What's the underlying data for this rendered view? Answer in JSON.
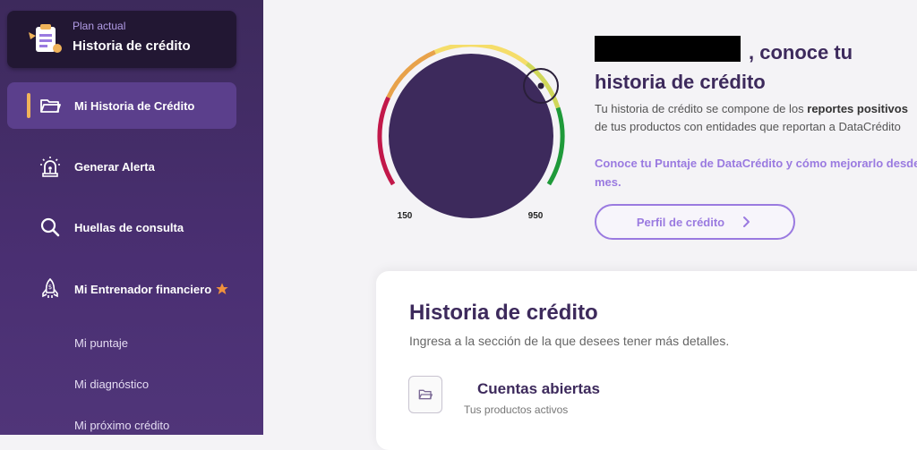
{
  "sidebar": {
    "plan": {
      "small": "Plan actual",
      "title": "Historia de crédito"
    },
    "items": [
      {
        "label": "Mi Historia de Crédito",
        "icon": "folder-icon",
        "active": true
      },
      {
        "label": "Generar Alerta",
        "icon": "alarm-light-icon",
        "active": false
      },
      {
        "label": "Huellas de consulta",
        "icon": "search-icon",
        "active": false
      },
      {
        "label": "Mi Entrenador financiero",
        "icon": "rocket-icon",
        "active": false,
        "badge": "star-icon"
      }
    ],
    "sub_items": [
      "Mi puntaje",
      "Mi diagnóstico",
      "Mi próximo crédito"
    ]
  },
  "gauge": {
    "min_label": "150",
    "max_label": "950"
  },
  "header": {
    "title_line1": ", conoce tu",
    "title_line2": "historia de crédito",
    "para_prefix": "Tu historia de crédito se compone de los ",
    "para_bold": "reportes positivos",
    "para_line2": "de tus productos con entidades que reportan a DataCrédito",
    "link_line1": "Conoce tu Puntaje de DataCrédito y cómo mejorarlo desde",
    "link_line2": "mes.",
    "profile_button": "Perfil de crédito"
  },
  "card": {
    "title": "Historia de crédito",
    "subtitle": "Ingresa a la sección de la que desees tener más detalles.",
    "account": {
      "title": "Cuentas abiertas",
      "subtitle": "Tus productos activos",
      "icon": "folder-icon"
    }
  },
  "colors": {
    "sidebar": "#3d2a5c",
    "accent": "#9a7ae0",
    "active_bar": "#f0b35a",
    "gauge_red": "#c2184a",
    "gauge_orange": "#e8a24a",
    "gauge_yellow": "#f5dd6a",
    "gauge_green": "#1f9a3a"
  }
}
